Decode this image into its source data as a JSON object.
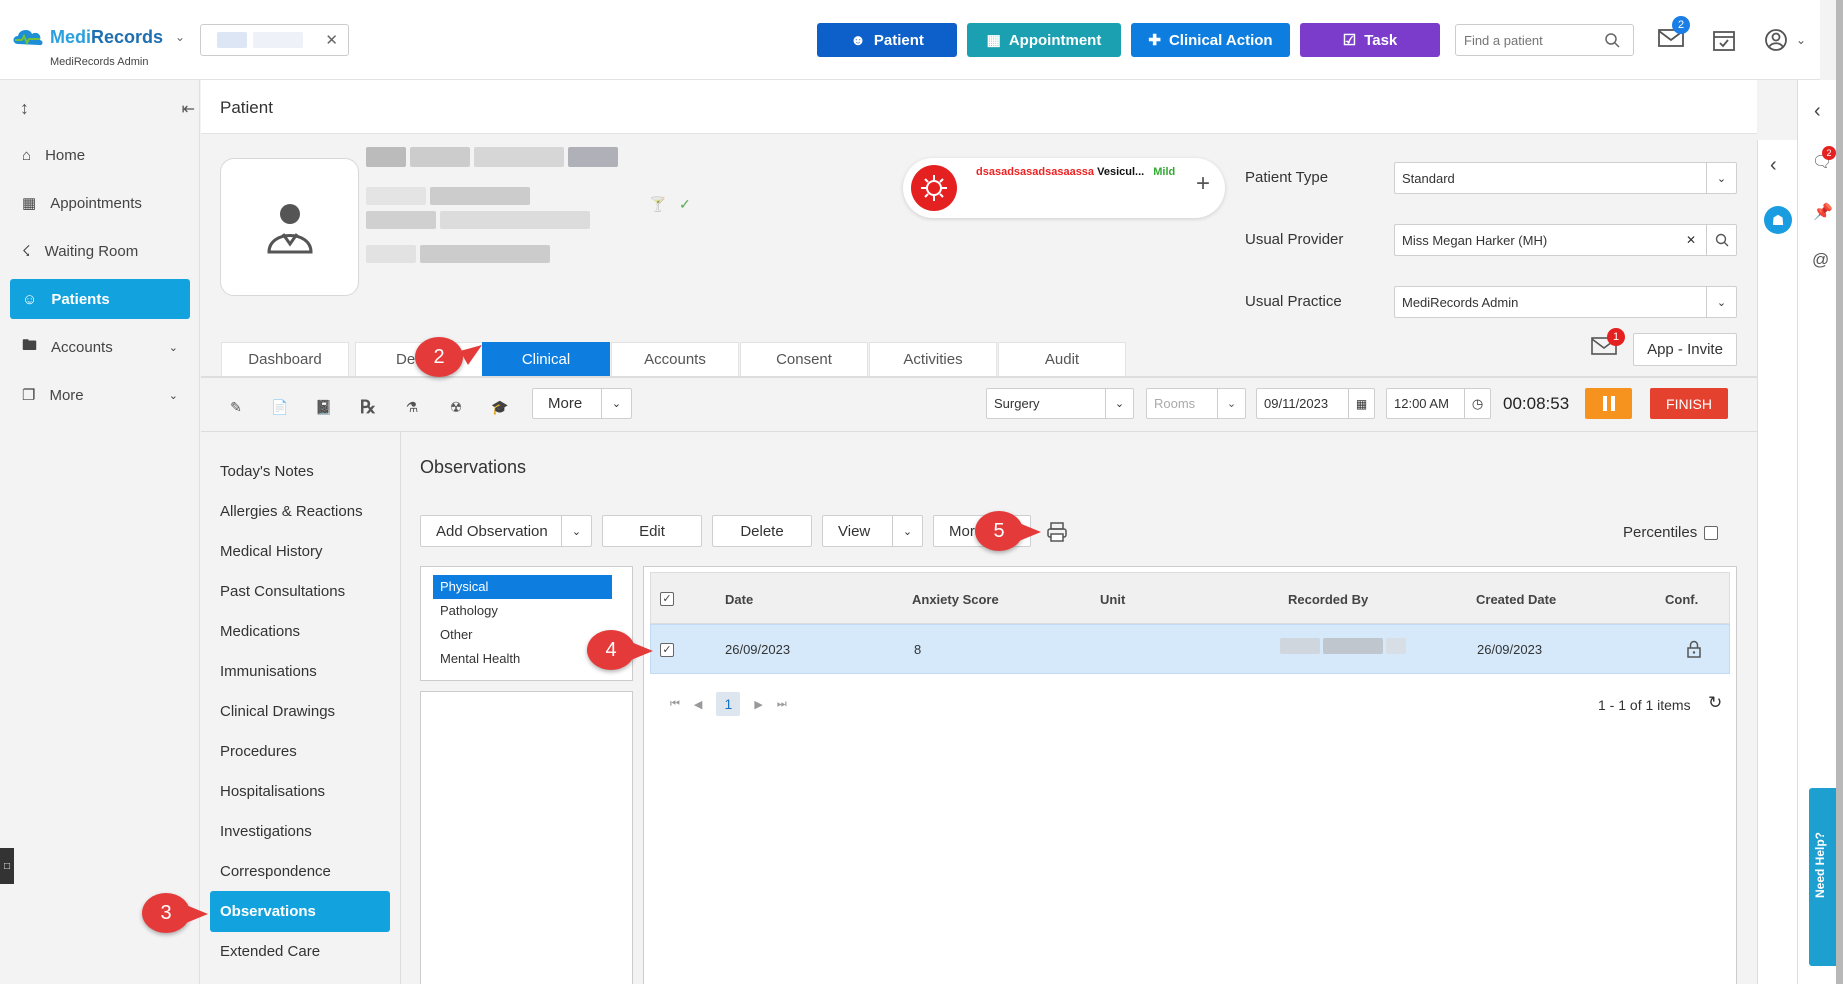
{
  "app": {
    "name_part1": "Medi",
    "name_part2": "Records",
    "subtitle": "MediRecords Admin"
  },
  "header": {
    "buttons": [
      {
        "label": "Patient",
        "color": "#0d5fc9"
      },
      {
        "label": "Appointment",
        "color": "#1aa0b0"
      },
      {
        "label": "Clinical Action",
        "color": "#0d7ee0"
      },
      {
        "label": "Task",
        "color": "#7b3ccc"
      }
    ],
    "search_placeholder": "Find a patient",
    "mail_badge": "2"
  },
  "sidebar": {
    "items": [
      {
        "label": "Home"
      },
      {
        "label": "Appointments"
      },
      {
        "label": "Waiting Room"
      },
      {
        "label": "Patients"
      },
      {
        "label": "Accounts"
      },
      {
        "label": "More"
      }
    ]
  },
  "page": {
    "title": "Patient"
  },
  "alert": {
    "red_text": "dsasadsasadsasaassa",
    "black_text": "Vesicul...",
    "severity": "Mild"
  },
  "patient_fields": {
    "type_label": "Patient Type",
    "type_value": "Standard",
    "provider_label": "Usual Provider",
    "provider_value": "Miss Megan Harker (MH)",
    "practice_label": "Usual Practice",
    "practice_value": "MediRecords Admin"
  },
  "tabs": [
    "Dashboard",
    "De",
    "Clinical",
    "Accounts",
    "Consent",
    "Activities",
    "Audit"
  ],
  "app_invite": {
    "label": "App - Invite",
    "badge": "1"
  },
  "toolbar": {
    "more_label": "More",
    "location": "Surgery",
    "rooms_placeholder": "Rooms",
    "date": "09/11/2023",
    "time": "12:00 AM",
    "timer": "00:08:53",
    "finish_label": "FINISH"
  },
  "left_menu": [
    "Today's Notes",
    "Allergies & Reactions",
    "Medical History",
    "Past Consultations",
    "Medications",
    "Immunisations",
    "Clinical Drawings",
    "Procedures",
    "Hospitalisations",
    "Investigations",
    "Correspondence",
    "Observations",
    "Extended Care"
  ],
  "observations": {
    "title": "Observations",
    "buttons": {
      "add": "Add Observation",
      "edit": "Edit",
      "delete": "Delete",
      "view": "View",
      "more": "Mor"
    },
    "percentiles_label": "Percentiles",
    "categories": [
      "Physical",
      "Pathology",
      "Other",
      "Mental Health"
    ],
    "columns": [
      "Date",
      "Anxiety Score",
      "Unit",
      "Recorded By",
      "Created Date",
      "Conf."
    ],
    "rows": [
      {
        "date": "26/09/2023",
        "score": "8",
        "unit": "",
        "created": "26/09/2023"
      }
    ],
    "page": "1",
    "items_text": "1 - 1 of 1 items"
  },
  "callouts": [
    "2",
    "3",
    "4",
    "5"
  ],
  "help": {
    "label": "Need Help?"
  },
  "right_badge": "2"
}
